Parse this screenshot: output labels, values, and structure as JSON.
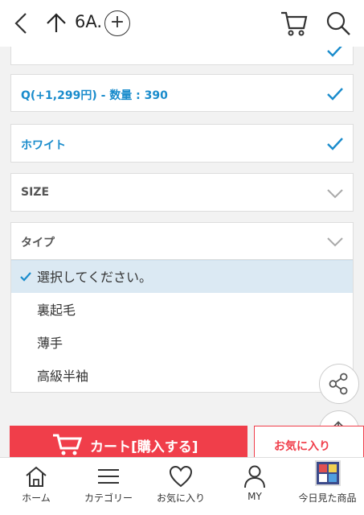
{
  "header": {
    "title": "6A.",
    "plus_label": "+"
  },
  "options": {
    "opt1": {
      "label": "Q(+1,299円) - 数量 : 390"
    },
    "opt2": {
      "label": "ホワイト"
    },
    "opt3": {
      "label": "SIZE"
    },
    "opt4": {
      "label": "タイプ"
    }
  },
  "dropdown": {
    "items": [
      {
        "label": "選択してください。"
      },
      {
        "label": "裏起毛"
      },
      {
        "label": "薄手"
      },
      {
        "label": "高級半袖"
      }
    ]
  },
  "actions": {
    "cart_label": "カート[購入する]",
    "fav_label": "お気に入り"
  },
  "tabs": [
    {
      "label": "ホーム"
    },
    {
      "label": "カテゴリー"
    },
    {
      "label": "お気に入り"
    },
    {
      "label": "MY"
    },
    {
      "label": "今日見た商品"
    }
  ],
  "colors": {
    "accent_blue": "#1a8ccc",
    "cart_red": "#f03e4a"
  }
}
